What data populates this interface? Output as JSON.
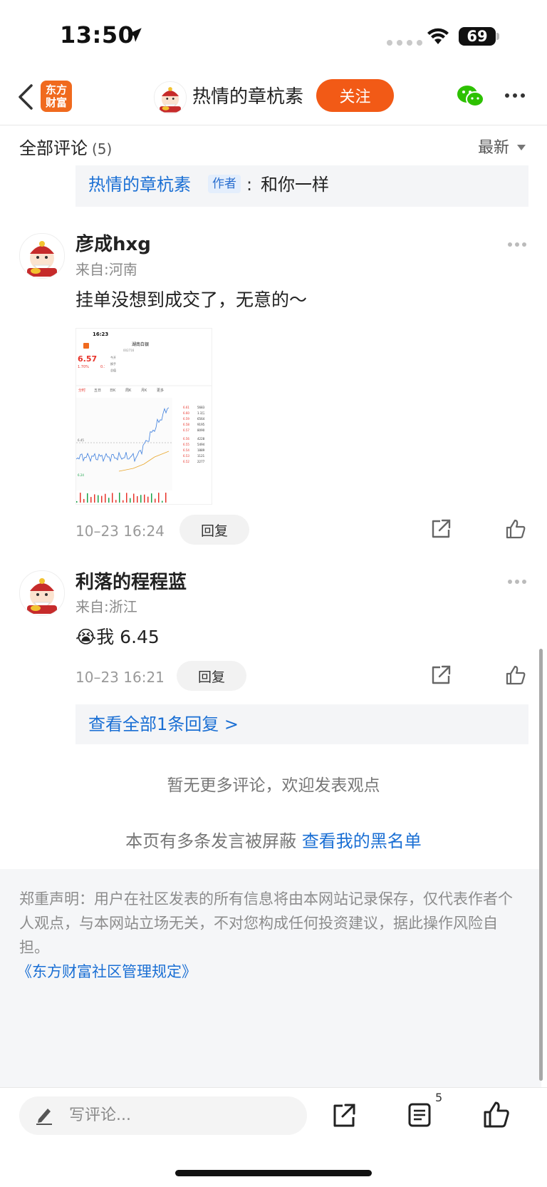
{
  "status_bar": {
    "time": "13:50",
    "battery": "69"
  },
  "nav": {
    "app_logo_line1": "东方",
    "app_logo_line2": "财富",
    "title": "热情的章杭素",
    "follow_label": "关注"
  },
  "comments_header": {
    "title": "全部评论",
    "count": "(5)",
    "sort_label": "最新"
  },
  "top_reply": {
    "author": "热情的章杭素",
    "author_tag": "作者",
    "separator": ":",
    "text": "和你一样"
  },
  "comments": [
    {
      "user": "彦成hxg",
      "from": "来自:河南",
      "text": "挂单没想到成交了，无意的～",
      "time": "10–23 16:24",
      "reply_label": "回复",
      "screenshot": {
        "time": "16:23",
        "stock_name": "湖南白银",
        "stock_code": "002716",
        "price": "6.57",
        "change_pct": "1.70%",
        "change": "0.11",
        "tabs": [
          "分时",
          "五日",
          "日K",
          "周K",
          "月K",
          "更多"
        ],
        "prices": [
          "6.61",
          "6.60",
          "6.59",
          "6.58",
          "6.57",
          "6.56",
          "6.55",
          "6.54",
          "6.53",
          "6.52"
        ],
        "volumes": [
          "5683",
          "1.3万",
          "6564",
          "9195",
          "8090",
          "4228",
          "5494",
          "1889",
          "1121",
          "2277"
        ],
        "low_label": "6.24",
        "mid_label": "6.45"
      }
    },
    {
      "user": "利落的程程蓝",
      "from": "来自:浙江",
      "emoji": "😭",
      "text": "我 6.45",
      "time": "10–23 16:21",
      "reply_label": "回复",
      "view_replies": "查看全部1条回复 >"
    }
  ],
  "no_more": "暂无更多评论，欢迎发表观点",
  "blocked": {
    "text": "本页有多条发言被屏蔽 ",
    "link": "查看我的黑名单"
  },
  "disclaimer": {
    "text": "郑重声明：用户在社区发表的所有信息将由本网站记录保存，仅代表作者个人观点，与本网站立场无关，不对您构成任何投资建议，据此操作风险自担。",
    "link": "《东方财富社区管理规定》"
  },
  "bottom_bar": {
    "placeholder": "写评论...",
    "list_count": "5"
  },
  "colors": {
    "brand_orange": "#f25a16",
    "link_blue": "#1a6fd4",
    "stock_red": "#e8332a",
    "stock_green": "#1aa34a"
  },
  "icons": [
    "location-arrow-icon",
    "wifi-icon",
    "back-chevron-icon",
    "wechat-icon",
    "more-dots-icon",
    "share-icon",
    "thumbs-up-icon",
    "pen-icon",
    "list-icon"
  ]
}
